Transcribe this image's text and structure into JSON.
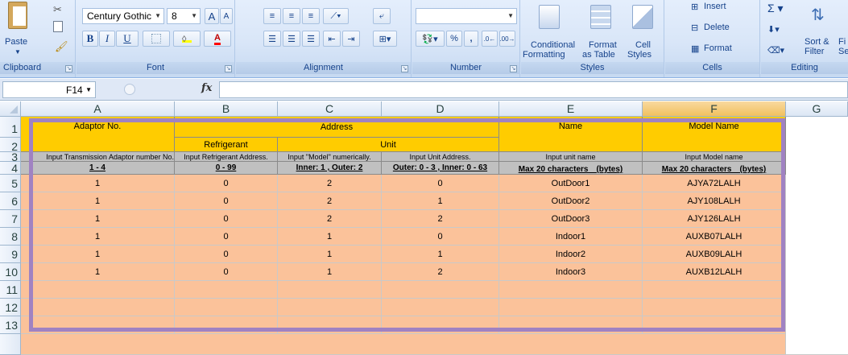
{
  "ribbon": {
    "clipboard": {
      "paste_label": "Paste",
      "group_label": "Clipboard"
    },
    "font": {
      "font_name": "Century Gothic",
      "font_size": "8",
      "bold": "B",
      "italic": "I",
      "underline": "U",
      "grow": "A",
      "shrink": "A",
      "font_color": "A",
      "group_label": "Font"
    },
    "alignment": {
      "group_label": "Alignment"
    },
    "number": {
      "format": "",
      "percent": "%",
      "comma": ",",
      "group_label": "Number"
    },
    "styles": {
      "conditional_1": "Conditional",
      "conditional_2": "Formatting",
      "format_table_1": "Format",
      "format_table_2": "as Table",
      "cell_styles_1": "Cell",
      "cell_styles_2": "Styles",
      "group_label": "Styles"
    },
    "cells": {
      "insert": "Insert",
      "delete": "Delete",
      "format": "Format",
      "group_label": "Cells"
    },
    "editing": {
      "sort_1": "Sort &",
      "sort_2": "Filter",
      "find_1": "Fi",
      "find_2": "Se",
      "group_label": "Editing"
    }
  },
  "formula_bar": {
    "name_box": "F14",
    "fx_label": "fx",
    "formula": ""
  },
  "columns": [
    "A",
    "B",
    "C",
    "D",
    "E",
    "F",
    "G"
  ],
  "selected_column": "F",
  "rows": [
    "1",
    "2",
    "3",
    "4",
    "5",
    "6",
    "7",
    "8",
    "9",
    "10",
    "11",
    "12",
    "13"
  ],
  "sheet": {
    "header": {
      "adaptor_no": "Adaptor No.",
      "address": "Address",
      "refrigerant": "Refrigerant",
      "unit": "Unit",
      "name": "Name",
      "model_name": "Model Name"
    },
    "instructions": {
      "a": "Input Transmission Adaptor number No.",
      "b": "Input Refrigerant Address.",
      "c": "Input \"Model\" numerically.",
      "d": "Input Unit Address.",
      "e": "Input unit name",
      "f": "Input Model name"
    },
    "ranges": {
      "a": "1 - 4",
      "b": "0 - 99",
      "c": "Inner: 1 , Outer: 2",
      "d": "Outer: 0 - 3 , Inner: 0 - 63",
      "e": "Max 20 characters　(bytes)",
      "f": "Max 20 characters　(bytes)"
    },
    "data_rows": [
      {
        "adaptor": "1",
        "refrigerant": "0",
        "model": "2",
        "unit": "0",
        "name": "OutDoor1",
        "model_name": "AJYA72LALH"
      },
      {
        "adaptor": "1",
        "refrigerant": "0",
        "model": "2",
        "unit": "1",
        "name": "OutDoor2",
        "model_name": "AJY108LALH"
      },
      {
        "adaptor": "1",
        "refrigerant": "0",
        "model": "2",
        "unit": "2",
        "name": "OutDoor3",
        "model_name": "AJY126LALH"
      },
      {
        "adaptor": "1",
        "refrigerant": "0",
        "model": "1",
        "unit": "0",
        "name": "Indoor1",
        "model_name": "AUXB07LALH"
      },
      {
        "adaptor": "1",
        "refrigerant": "0",
        "model": "1",
        "unit": "1",
        "name": "Indoor2",
        "model_name": "AUXB09LALH"
      },
      {
        "adaptor": "1",
        "refrigerant": "0",
        "model": "1",
        "unit": "2",
        "name": "Indoor3",
        "model_name": "AUXB12LALH"
      }
    ]
  },
  "colors": {
    "highlight_frame": "#a082c2",
    "header_yellow": "#ffcc00",
    "data_peach": "#fbc29a",
    "instruction_gray": "#c0c0c0"
  }
}
